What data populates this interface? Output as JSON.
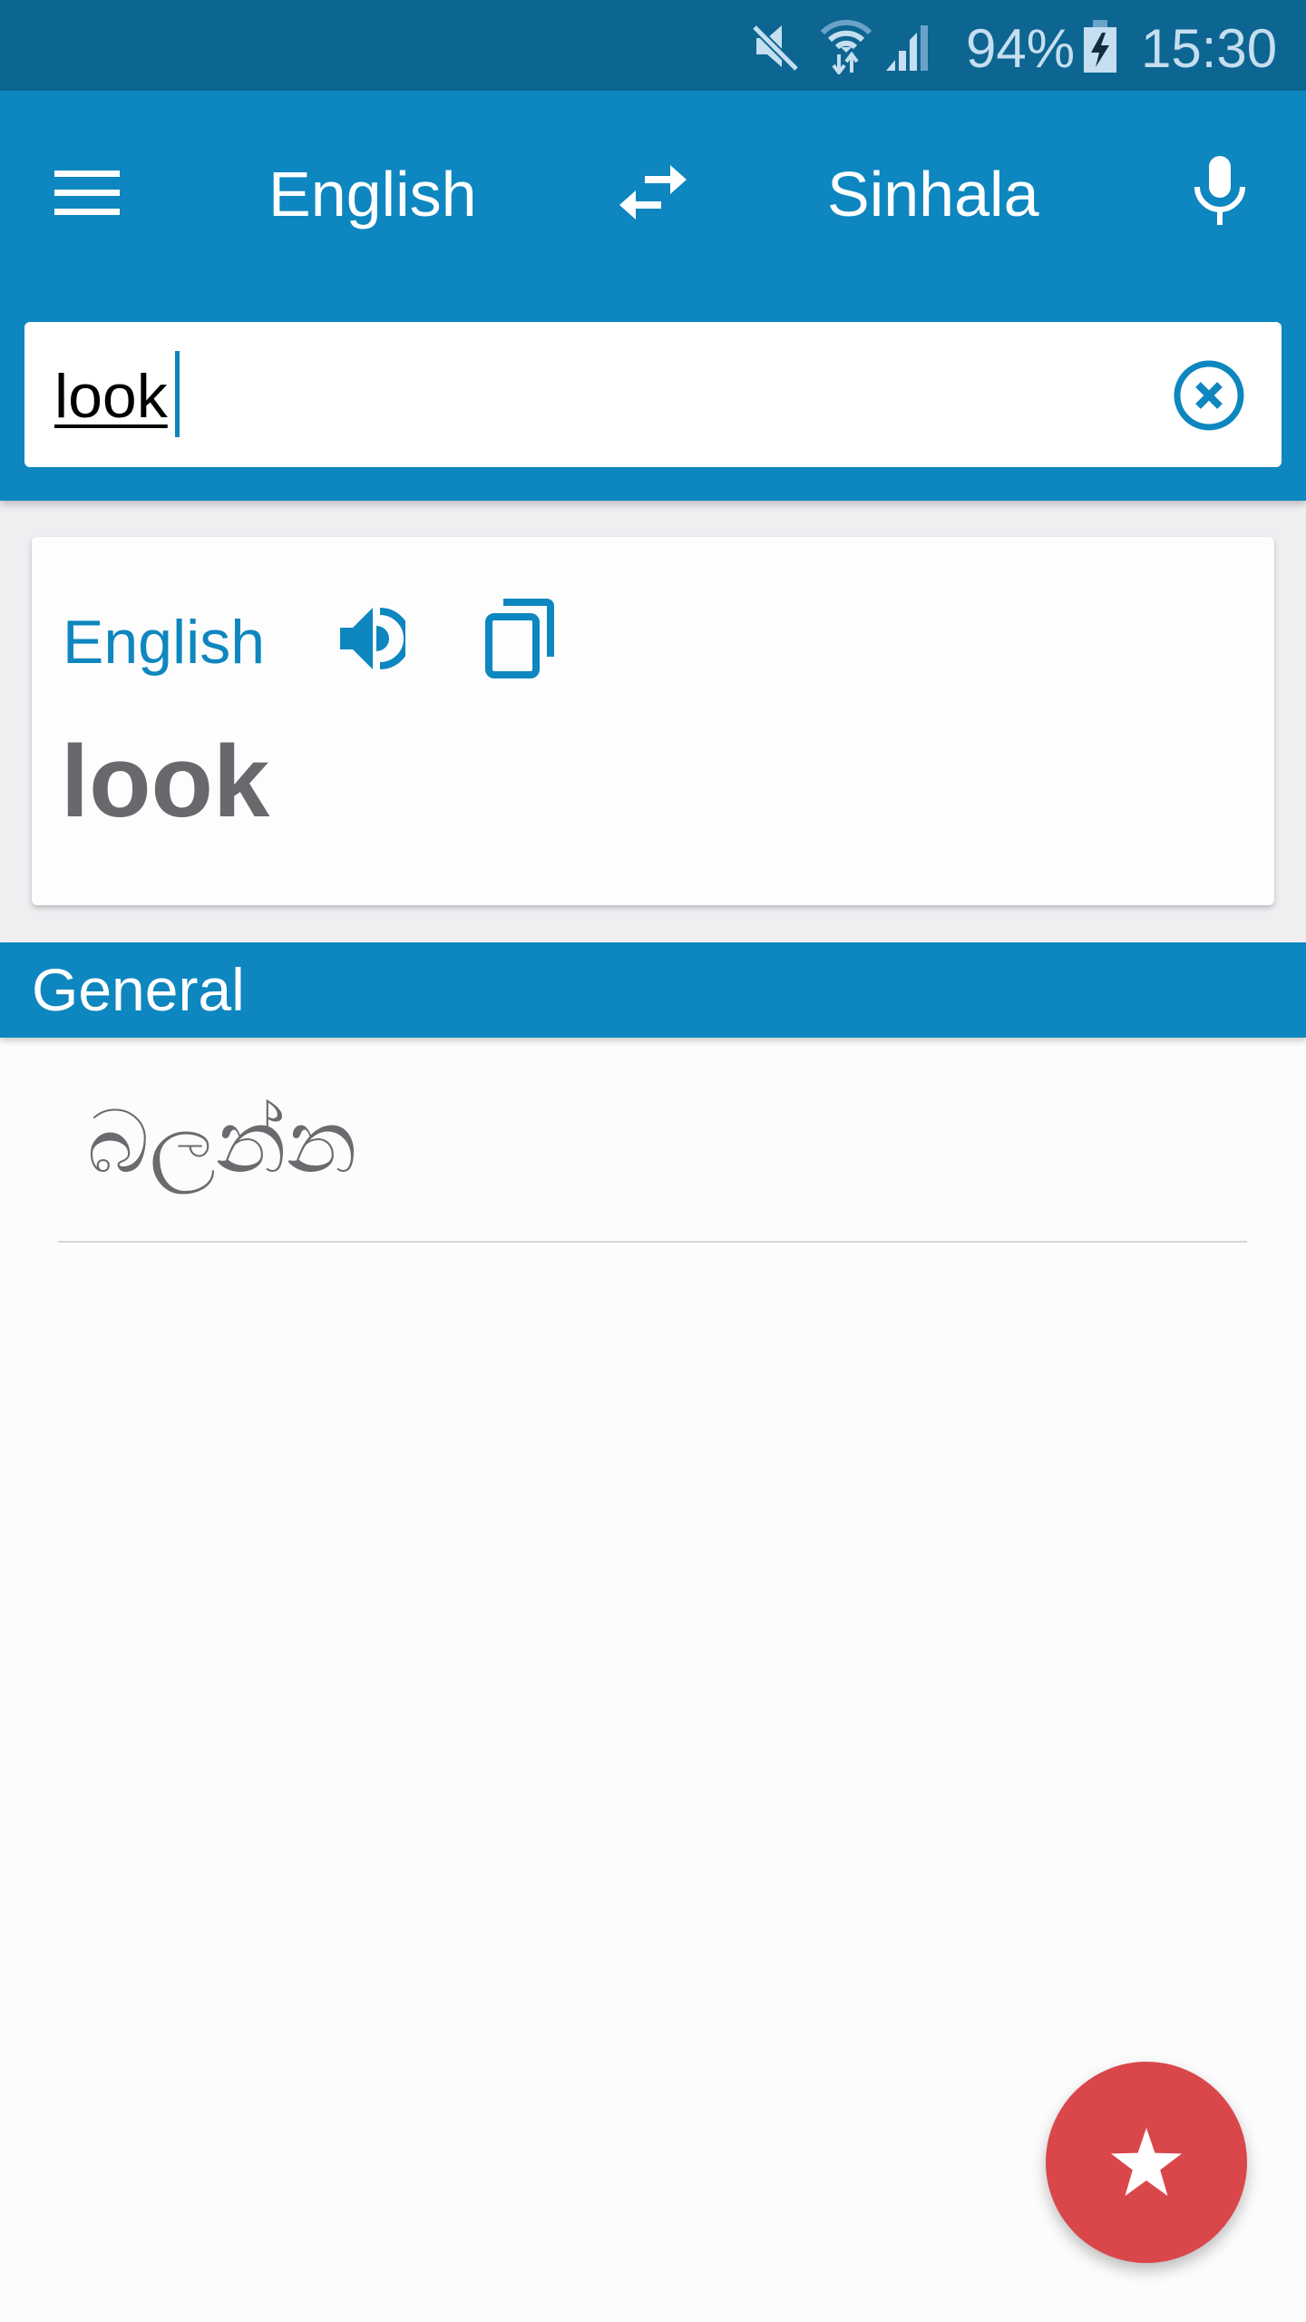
{
  "status_bar": {
    "battery_percent": "94%",
    "time": "15:30",
    "icons": [
      "mute-icon",
      "wifi-icon",
      "signal-icon",
      "battery-charging-icon"
    ]
  },
  "header": {
    "menu_icon": "hamburger-menu-icon",
    "source_language": "English",
    "swap_icon": "swap-languages-icon",
    "target_language": "Sinhala",
    "mic_icon": "microphone-icon"
  },
  "search": {
    "value": "look",
    "clear_icon": "clear-circle-icon"
  },
  "card": {
    "language_label": "English",
    "speak_icon": "speaker-icon",
    "copy_icon": "copy-icon",
    "word": "look"
  },
  "section": {
    "title": "General",
    "results": [
      {
        "text": "බලන්න"
      }
    ]
  },
  "fab": {
    "icon": "star-icon",
    "color": "#d9474b"
  },
  "colors": {
    "primary": "#0e86bf",
    "status_bar": "#0d6591",
    "accent": "#d9474b"
  }
}
